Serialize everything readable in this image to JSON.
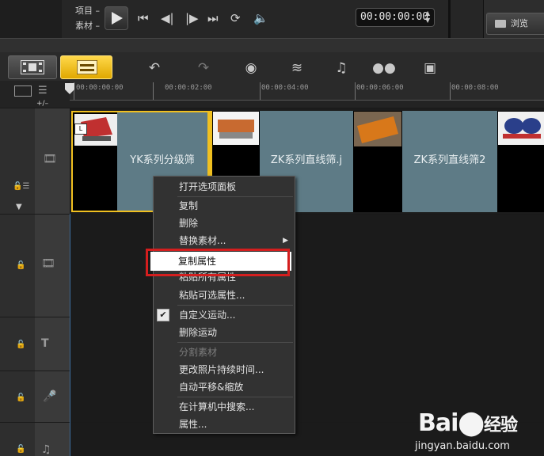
{
  "player": {
    "project_label": "项目 –",
    "clip_label": "素材 –",
    "timecode": "00:00:00:00",
    "browse_label": "浏览"
  },
  "ruler": {
    "ticks": [
      "00:00:00:00",
      "00:00:02:00",
      "00:00:04:00",
      "00:00:06:00",
      "00:00:08:00"
    ],
    "zoom": "+/–"
  },
  "clips": [
    {
      "title": "YK系列分级筛",
      "selected": true
    },
    {
      "title": "ZK系列直线筛.j"
    },
    {
      "title": "ZK系列直线筛2"
    }
  ],
  "context_menu": {
    "items": [
      {
        "label": "打开选项面板"
      },
      {
        "label": "复制"
      },
      {
        "label": "删除"
      },
      {
        "label": "替换素材...",
        "submenu": true
      },
      {
        "label": "复制属性",
        "highlighted": true
      },
      {
        "label": "粘贴所有属性"
      },
      {
        "label": "粘贴可选属性..."
      },
      {
        "label": "自定义运动...",
        "checked": true
      },
      {
        "label": "删除运动"
      },
      {
        "label": "分割素材",
        "disabled": true
      },
      {
        "label": "更改照片持续时间..."
      },
      {
        "label": "自动平移&缩放"
      },
      {
        "label": "在计算机中搜索..."
      },
      {
        "label": "属性..."
      }
    ]
  },
  "watermark": {
    "brand": "Bai",
    "brand_suffix": "经验",
    "url": "jingyan.baidu.com"
  },
  "colors": {
    "accent_yellow": "#f0c020",
    "highlight_red": "#d41e1e",
    "title_clip": "#5e7b86"
  }
}
